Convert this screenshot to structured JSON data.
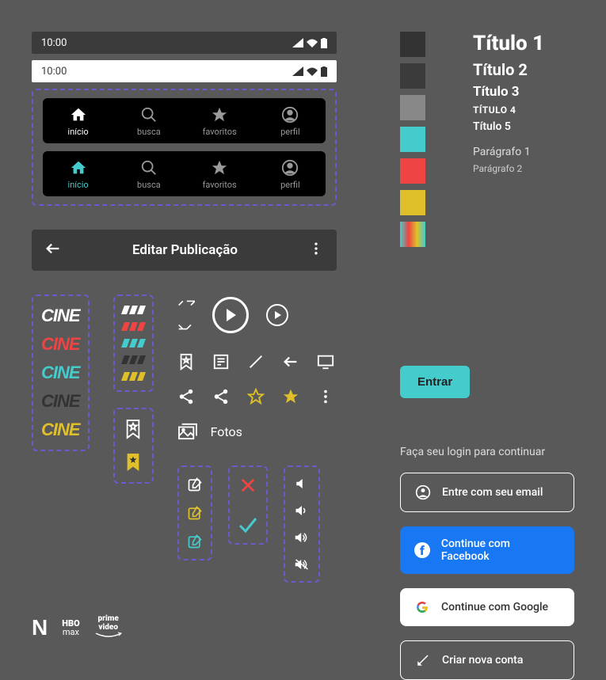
{
  "status_time": "10:00",
  "nav": {
    "items": [
      {
        "label": "início"
      },
      {
        "label": "busca"
      },
      {
        "label": "favoritos"
      },
      {
        "label": "perfil"
      }
    ]
  },
  "header": {
    "title": "Editar Publicação"
  },
  "logo_text": "CINE",
  "photos_label": "Fotos",
  "streaming": {
    "netflix": "N",
    "hbo1": "HBO",
    "hbo2": "max",
    "prime1": "prime",
    "prime2": "video"
  },
  "typography": {
    "t1": "Título 1",
    "t2": "Título 2",
    "t3": "Título 3",
    "t4": "TÍTULO 4",
    "t5": "Título 5",
    "p1": "Parágrafo 1",
    "p2": "Parágrafo 2"
  },
  "colors": {
    "dark1": "#333333",
    "dark2": "#3b3b3b",
    "gray": "#888888",
    "teal": "#44cccc",
    "red": "#ef4444",
    "yellow": "#e0c02a"
  },
  "cta": {
    "entrar": "Entrar"
  },
  "login": {
    "prompt": "Faça seu login para continuar",
    "email": "Entre com seu email",
    "facebook": "Continue com Facebook",
    "google": "Continue com Google",
    "create": "Criar nova conta"
  }
}
